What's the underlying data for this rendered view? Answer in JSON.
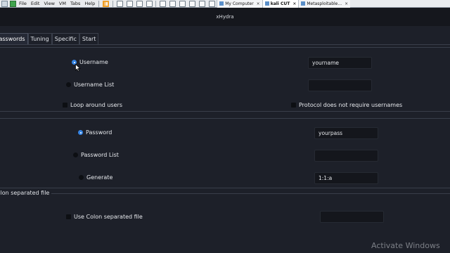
{
  "host": {
    "menus": [
      "File",
      "Edit",
      "View",
      "VM",
      "Tabs",
      "Help"
    ],
    "vm_tabs": [
      {
        "label": "My Computer",
        "active": false
      },
      {
        "label": "kali CUT",
        "active": true
      },
      {
        "label": "Metasploitable...",
        "active": false
      }
    ],
    "close_glyph": "×"
  },
  "window": {
    "title": "xHydra"
  },
  "tabs": [
    {
      "label": "Passwords",
      "active": true
    },
    {
      "label": "Tuning",
      "active": false
    },
    {
      "label": "Specific",
      "active": false
    },
    {
      "label": "Start",
      "active": false
    }
  ],
  "username": {
    "single_label": "Username",
    "single_checked": true,
    "single_value": "yourname",
    "list_label": "Username List",
    "list_checked": false,
    "list_value": "",
    "loop_label": "Loop around users",
    "loop_checked": false,
    "no_user_label": "Protocol does not require usernames",
    "no_user_checked": false
  },
  "password": {
    "single_label": "Password",
    "single_checked": true,
    "single_value": "yourpass",
    "list_label": "Password List",
    "list_checked": false,
    "list_value": "",
    "generate_label": "Generate",
    "generate_checked": false,
    "generate_value": "1:1:a"
  },
  "colon": {
    "frame_label": "Colon separated file",
    "use_label": "Use Colon separated file",
    "use_checked": false,
    "file_value": ""
  },
  "watermark": "Activate Windows"
}
